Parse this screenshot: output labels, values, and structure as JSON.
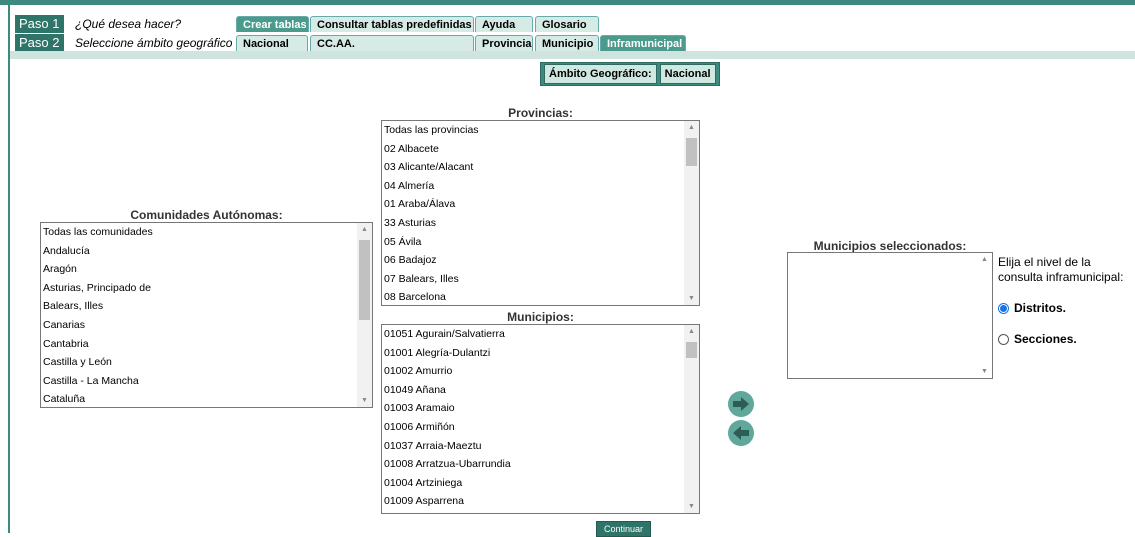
{
  "steps": [
    {
      "badge": "Paso 1",
      "text": "¿Qué desea hacer?"
    },
    {
      "badge": "Paso 2",
      "text": "Seleccione ámbito geográfico"
    }
  ],
  "row1_tabs": [
    "Crear tablas",
    "Consultar tablas predefinidas",
    "Ayuda",
    "Glosario"
  ],
  "row2_tabs": [
    "Nacional",
    "CC.AA.",
    "Provincia",
    "Municipio",
    "Inframunicipal"
  ],
  "ambito": {
    "label": "Ámbito Geográfico:",
    "value": "Nacional"
  },
  "comunidades": {
    "label": "Comunidades Autónomas:",
    "items": [
      "Todas las comunidades",
      "Andalucía",
      "Aragón",
      "Asturias, Principado de",
      "Balears, Illes",
      "Canarias",
      "Cantabria",
      "Castilla y León",
      "Castilla - La Mancha",
      "Cataluña"
    ]
  },
  "provincias": {
    "label": "Provincias:",
    "items": [
      "Todas las provincias",
      "02 Albacete",
      "03 Alicante/Alacant",
      "04 Almería",
      "01 Araba/Álava",
      "33 Asturias",
      "05 Ávila",
      "06 Badajoz",
      "07 Balears, Illes",
      "08 Barcelona"
    ]
  },
  "municipios": {
    "label": "Municipios:",
    "items": [
      "01051 Agurain/Salvatierra",
      "01001 Alegría-Dulantzi",
      "01002 Amurrio",
      "01049 Añana",
      "01003 Aramaio",
      "01006 Armiñón",
      "01037 Arraia-Maeztu",
      "01008 Arratzua-Ubarrundia",
      "01004 Artziniega",
      "01009 Asparrena"
    ]
  },
  "seleccionados": {
    "label": "Municipios seleccionados:"
  },
  "nivel": {
    "prompt": "Elija el nivel de la consulta inframunicipal:",
    "options": [
      "Distritos.",
      "Secciones."
    ],
    "selected": "Distritos."
  },
  "continuar_label": "Continuar",
  "colors": {
    "accent": "#3d8a7e",
    "dark": "#2e7468",
    "tab_bg": "#d7ebe6",
    "radio": "#1a73e8"
  }
}
